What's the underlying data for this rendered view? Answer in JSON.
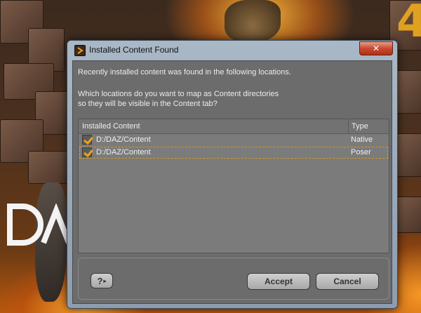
{
  "dialog": {
    "title": "Installed Content Found",
    "close_glyph": "✕",
    "message_line1": "Recently installed content was found in the following locations.",
    "message_line2": "Which locations do you want to map as Content directories",
    "message_line3": "so they will be visible in the Content tab?",
    "table": {
      "columns": [
        "Installed Content",
        "Type"
      ],
      "rows": [
        {
          "path": "D:/DAZ/Content",
          "type": "Native",
          "checked": true,
          "selected": false
        },
        {
          "path": "D:/DAZ/Content",
          "type": "Poser",
          "checked": true,
          "selected": true
        }
      ]
    },
    "buttons": {
      "help_glyph": "?",
      "accept": "Accept",
      "cancel": "Cancel"
    }
  },
  "background": {
    "logo_text": "DAZ",
    "accent_color": "#e0a020"
  }
}
